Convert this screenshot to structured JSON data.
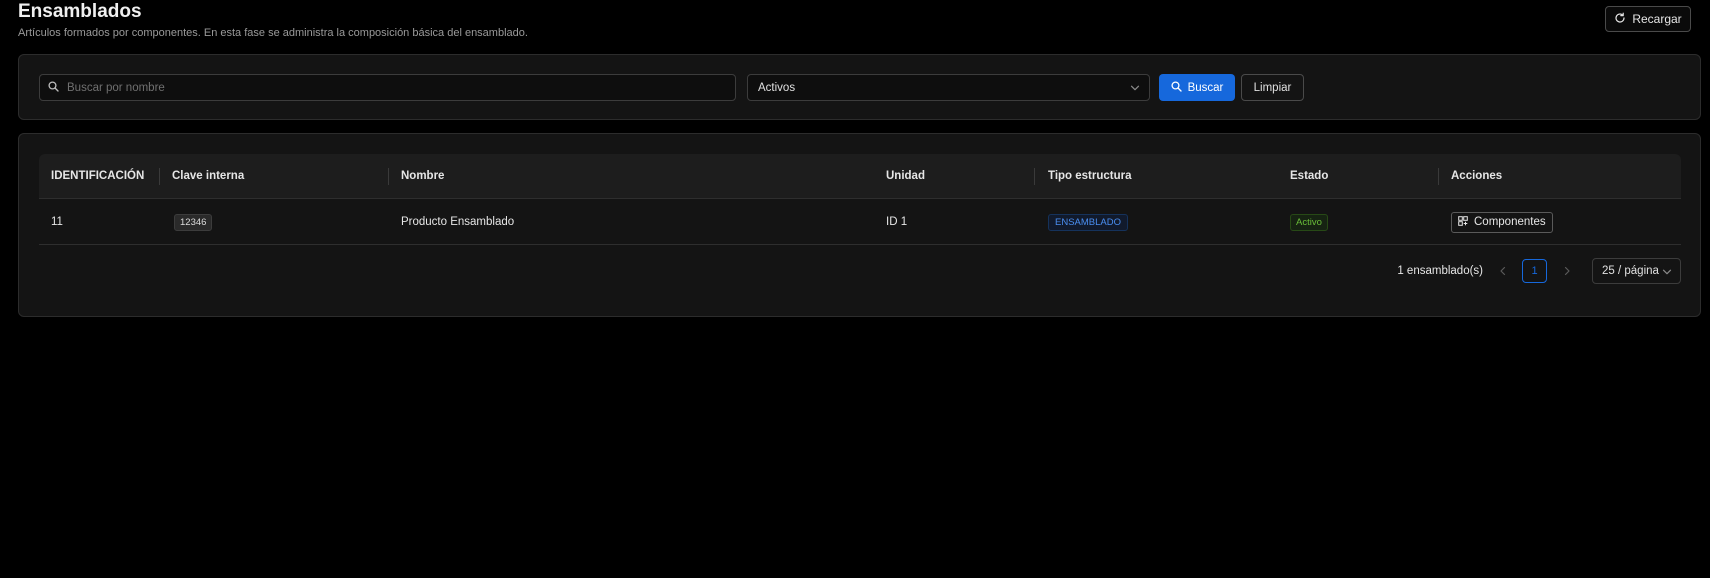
{
  "header": {
    "title": "Ensamblados",
    "subtitle": "Artículos formados por componentes. En esta fase se administra la composición básica del ensamblado.",
    "reload_label": "Recargar"
  },
  "filters": {
    "search_placeholder": "Buscar por nombre",
    "search_value": "",
    "status_selected": "Activos",
    "search_button": "Buscar",
    "clear_button": "Limpiar"
  },
  "table": {
    "columns": [
      "IDENTIFICACIÓN",
      "Clave interna",
      "Nombre",
      "Unidad",
      "Tipo estructura",
      "Estado",
      "Acciones"
    ],
    "rows": [
      {
        "id": "11",
        "code": "12346",
        "name": "Producto Ensamblado",
        "unit": "ID 1",
        "structure_type": "ENSAMBLADO",
        "status": "Activo",
        "action": "Componentes"
      }
    ]
  },
  "pagination": {
    "total_label": "1 ensamblado(s)",
    "current_page": "1",
    "page_size": "25 / página"
  },
  "colors": {
    "primary": "#1668dc",
    "status_active": "#6abe39",
    "type_tag": "#4a8ef0"
  },
  "icons": {
    "reload": "reload-icon",
    "search_input": "search-icon",
    "search_button": "search-icon",
    "select_arrow": "chevron-down-icon",
    "components": "components-icon",
    "prev": "chevron-left-icon",
    "next": "chevron-right-icon"
  }
}
